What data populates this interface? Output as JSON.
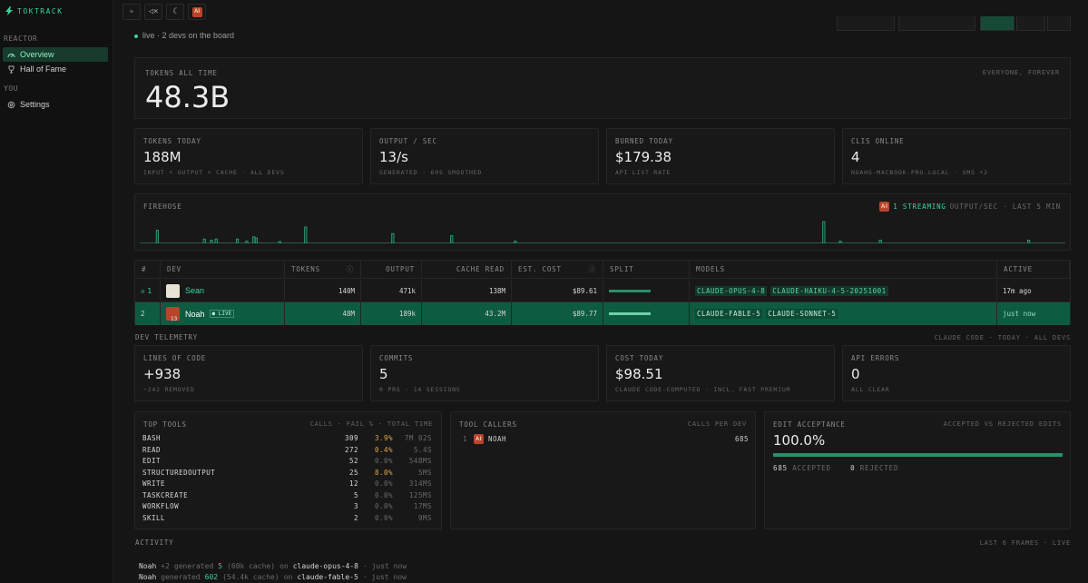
{
  "app": {
    "name": "TOKTRACK"
  },
  "sidebar": {
    "section1": "REACTOR",
    "items": [
      {
        "label": "Overview",
        "icon": "gauge-icon"
      },
      {
        "label": "Hall of Fame",
        "icon": "trophy-icon"
      }
    ],
    "section2": "YOU",
    "settings": {
      "label": "Settings",
      "icon": "gear-icon"
    }
  },
  "topbar": {
    "buttons": [
      "sparkle-icon",
      "mute-icon",
      "moon-icon"
    ],
    "avatar": "AI"
  },
  "status": {
    "live": "live · 2 devs on the board"
  },
  "hero": {
    "label": "TOKENS ALL TIME",
    "value": "48.3B",
    "scope": "EVERYONE, FOREVER"
  },
  "stats": [
    {
      "label": "TOKENS TODAY",
      "value": "188M",
      "sub": "INPUT + OUTPUT + CACHE · ALL DEVS"
    },
    {
      "label": "OUTPUT / SEC",
      "value": "13/s",
      "sub": "GENERATED · 60S SMOOTHED"
    },
    {
      "label": "BURNED TODAY",
      "value": "$179.38",
      "sub": "API LIST RATE"
    },
    {
      "label": "CLIS ONLINE",
      "value": "4",
      "sub": "NOAHS-MACBOOK-PRO.LOCAL · SMS +2"
    }
  ],
  "firehose": {
    "label": "FIREHOSE",
    "streaming": "1 STREAMING",
    "meta": "OUTPUT/SEC · LAST 5 MIN"
  },
  "chart_data": {
    "type": "bar",
    "title": "FIREHOSE",
    "xlabel": "",
    "ylabel": "",
    "x_range": "last 5 min",
    "values": [
      0,
      0,
      0,
      0,
      0,
      0,
      0,
      0.6,
      0,
      0,
      0,
      0,
      0,
      0,
      0,
      0,
      0,
      0,
      0,
      0,
      0,
      0,
      0,
      0,
      0,
      0,
      0,
      0.2,
      0,
      0,
      0.15,
      0,
      0.2,
      0,
      0,
      0,
      0,
      0,
      0,
      0,
      0,
      0.2,
      0,
      0,
      0,
      0.1,
      0,
      0,
      0.3,
      0.25,
      0,
      0,
      0,
      0,
      0,
      0,
      0,
      0,
      0,
      0.05,
      0,
      0,
      0,
      0,
      0,
      0,
      0,
      0,
      0,
      0,
      0.75,
      0,
      0,
      0,
      0,
      0,
      0,
      0,
      0,
      0,
      0,
      0,
      0,
      0,
      0,
      0,
      0,
      0,
      0,
      0,
      0,
      0,
      0,
      0,
      0,
      0,
      0,
      0,
      0,
      0,
      0,
      0,
      0,
      0,
      0,
      0,
      0,
      0.45,
      0,
      0,
      0,
      0,
      0,
      0,
      0,
      0,
      0,
      0,
      0,
      0,
      0,
      0,
      0,
      0,
      0,
      0,
      0,
      0,
      0,
      0,
      0,
      0,
      0.35,
      0,
      0,
      0,
      0,
      0,
      0,
      0,
      0,
      0,
      0,
      0,
      0,
      0,
      0,
      0,
      0,
      0,
      0,
      0,
      0,
      0,
      0,
      0,
      0,
      0,
      0,
      0.1,
      0,
      0,
      0,
      0,
      0,
      0,
      0,
      0,
      0,
      0,
      0,
      0,
      0,
      0,
      0,
      0,
      0,
      0,
      0,
      0,
      0,
      0,
      0,
      0,
      0,
      0,
      0,
      0,
      0,
      0,
      0,
      0,
      0,
      0,
      0,
      0,
      0,
      0,
      0,
      0,
      0,
      0,
      0,
      0,
      0,
      0,
      0,
      0,
      0,
      0,
      0,
      0,
      0,
      0,
      0,
      0,
      0,
      0,
      0,
      0,
      0,
      0,
      0,
      0,
      0,
      0,
      0,
      0,
      0,
      0,
      0,
      0,
      0,
      0,
      0,
      0,
      0,
      0,
      0,
      0,
      0,
      0,
      0,
      0,
      0,
      0,
      0,
      0,
      0,
      0,
      0,
      0,
      0,
      0,
      0,
      0,
      0,
      0,
      0,
      0,
      0,
      0,
      0,
      0,
      0,
      0,
      0,
      0,
      0,
      0,
      0,
      0,
      0,
      0,
      0,
      0,
      0,
      0,
      0,
      0,
      0,
      0,
      0,
      0,
      0,
      0,
      0,
      0,
      0,
      0,
      1.0,
      0,
      0,
      0,
      0,
      0,
      0,
      0.1,
      0,
      0,
      0,
      0,
      0,
      0,
      0,
      0,
      0,
      0,
      0,
      0,
      0,
      0,
      0,
      0,
      0.15,
      0,
      0,
      0,
      0,
      0,
      0,
      0,
      0,
      0,
      0,
      0,
      0,
      0,
      0,
      0,
      0,
      0,
      0,
      0,
      0,
      0,
      0,
      0,
      0,
      0,
      0,
      0,
      0,
      0,
      0,
      0,
      0,
      0,
      0,
      0,
      0,
      0,
      0,
      0,
      0,
      0,
      0,
      0,
      0,
      0,
      0,
      0,
      0,
      0,
      0,
      0,
      0,
      0,
      0,
      0,
      0,
      0,
      0,
      0,
      0,
      0,
      0,
      0.15,
      0,
      0,
      0,
      0,
      0,
      0,
      0,
      0,
      0,
      0,
      0,
      0,
      0,
      0,
      0
    ]
  },
  "table": {
    "headers": [
      "#",
      "DEV",
      "TOKENS",
      "OUTPUT",
      "CACHE READ",
      "EST. COST",
      "SPLIT",
      "MODELS",
      "ACTIVE"
    ],
    "rows": [
      {
        "rank": "1",
        "name": "Sean",
        "level": "12",
        "tokens": "140M",
        "output": "471k",
        "cache": "138M",
        "cost": "$89.61",
        "split": 1.0,
        "models": [
          "CLAUDE-OPUS-4-8",
          "CLAUDE-HAIKU-4-5-20251001"
        ],
        "active": "17m ago",
        "live": ""
      },
      {
        "rank": "2",
        "name": "Noah",
        "level": "13",
        "tokens": "48M",
        "output": "189k",
        "cache": "43.2M",
        "cost": "$89.77",
        "split": 1.0,
        "models": [
          "CLAUDE-FABLE-5",
          "CLAUDE-SONNET-5"
        ],
        "active": "just now",
        "live": "● LIVE"
      }
    ]
  },
  "telemetry": {
    "label": "DEV TELEMETRY",
    "meta": "CLAUDE CODE · TODAY · ALL DEVS",
    "cards": [
      {
        "label": "LINES OF CODE",
        "value": "+938",
        "sub": "−242 REMOVED"
      },
      {
        "label": "COMMITS",
        "value": "5",
        "sub": "0 PRS · 14 SESSIONS"
      },
      {
        "label": "COST TODAY",
        "value": "$98.51",
        "sub": "CLAUDE CODE-COMPUTED · INCL. FAST PREMIUM"
      },
      {
        "label": "API ERRORS",
        "value": "0",
        "sub": "ALL CLEAR"
      }
    ]
  },
  "tools": {
    "label": "TOP TOOLS",
    "meta": "CALLS · FAIL % · TOTAL TIME",
    "rows": [
      {
        "name": "BASH",
        "calls": "309",
        "fail": "3.9%",
        "time": "7M 02S",
        "hot": true
      },
      {
        "name": "READ",
        "calls": "272",
        "fail": "0.4%",
        "time": "5.4S",
        "hot": true
      },
      {
        "name": "EDIT",
        "calls": "52",
        "fail": "0.0%",
        "time": "548MS",
        "hot": false
      },
      {
        "name": "STRUCTUREDOUTPUT",
        "calls": "25",
        "fail": "8.0%",
        "time": "5MS",
        "hot": true
      },
      {
        "name": "WRITE",
        "calls": "12",
        "fail": "0.0%",
        "time": "314MS",
        "hot": false
      },
      {
        "name": "TASKCREATE",
        "calls": "5",
        "fail": "0.0%",
        "time": "125MS",
        "hot": false
      },
      {
        "name": "WORKFLOW",
        "calls": "3",
        "fail": "0.0%",
        "time": "17MS",
        "hot": false
      },
      {
        "name": "SKILL",
        "calls": "2",
        "fail": "0.0%",
        "time": "9MS",
        "hot": false
      }
    ]
  },
  "callers": {
    "label": "TOOL CALLERS",
    "meta": "CALLS PER DEV",
    "rows": [
      {
        "rank": "1",
        "name": "NOAH",
        "calls": "685"
      }
    ]
  },
  "edit": {
    "label": "EDIT ACCEPTANCE",
    "meta": "ACCEPTED VS REJECTED EDITS",
    "value": "100.0%",
    "ratio": 1.0,
    "accepted": "685",
    "accepted_label": "ACCEPTED",
    "rejected": "0",
    "rejected_label": "REJECTED"
  },
  "activity": {
    "label": "ACTIVITY",
    "meta": "LAST 6 FRAMES · LIVE",
    "rows": [
      {
        "who": "Noah",
        "extra": "+2",
        "verb": "generated",
        "n": "5",
        "cache": "(60k cache)",
        "on": "on",
        "model": "claude-opus-4-8",
        "when": "· just now"
      },
      {
        "who": "Noah",
        "extra": "",
        "verb": "generated",
        "n": "602",
        "cache": "(54.4k cache)",
        "on": "on",
        "model": "claude-fable-5",
        "when": "· just now"
      }
    ]
  },
  "colors": {
    "accent": "#3bd39a",
    "highlight_row": "#0d5b40",
    "warn": "#e2a84a"
  }
}
